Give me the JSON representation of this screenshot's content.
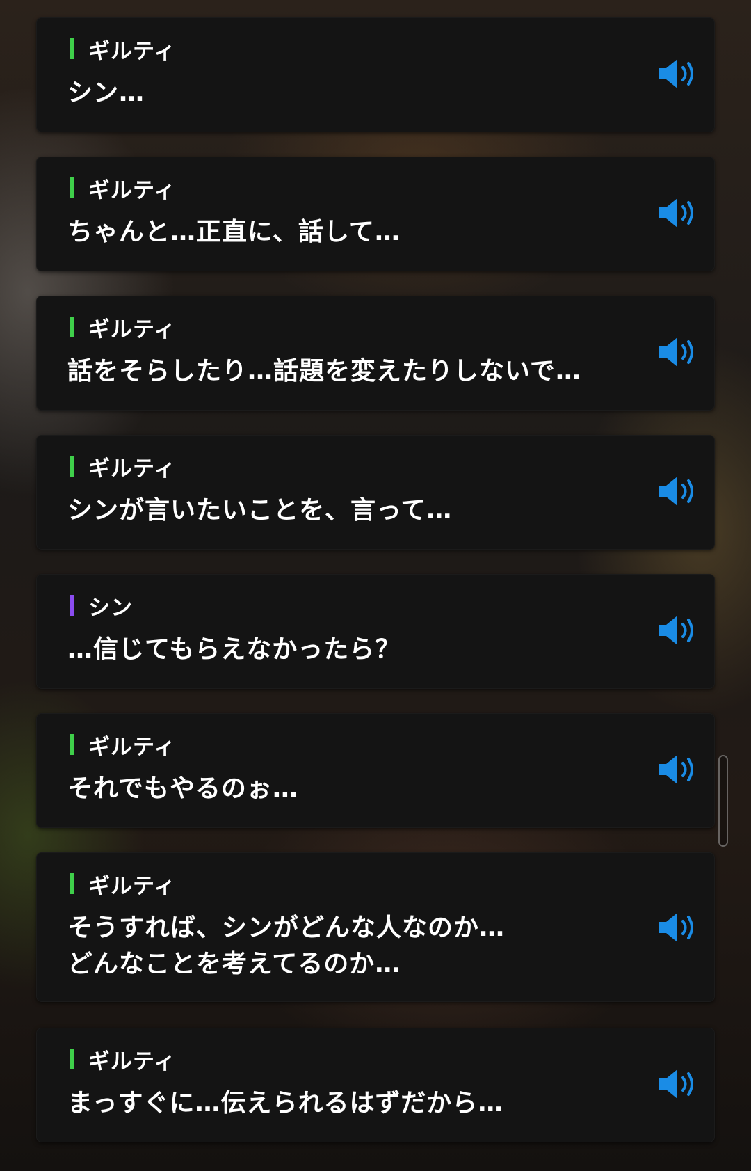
{
  "colors": {
    "speaker_bar_guilty": "#3fcf4a",
    "speaker_bar_shin": "#8b4cf0",
    "voice_icon": "#1a8ce6",
    "card_background": "#141414"
  },
  "log": [
    {
      "speaker": "ギルティ",
      "bar": "guilty",
      "lines": [
        "シン…"
      ],
      "icon": "speaker-voice-icon"
    },
    {
      "speaker": "ギルティ",
      "bar": "guilty",
      "lines": [
        "ちゃんと…正直に、話して…"
      ],
      "icon": "speaker-voice-icon"
    },
    {
      "speaker": "ギルティ",
      "bar": "guilty",
      "lines": [
        "話をそらしたり…話題を変えたりしないで…"
      ],
      "icon": "speaker-voice-icon"
    },
    {
      "speaker": "ギルティ",
      "bar": "guilty",
      "lines": [
        "シンが言いたいことを、言って…"
      ],
      "icon": "speaker-voice-icon"
    },
    {
      "speaker": "シン",
      "bar": "shin",
      "lines": [
        "…信じてもらえなかったら？"
      ],
      "icon": "speaker-voice-icon"
    },
    {
      "speaker": "ギルティ",
      "bar": "guilty",
      "lines": [
        "それでもやるのぉ…"
      ],
      "icon": "speaker-voice-icon"
    },
    {
      "speaker": "ギルティ",
      "bar": "guilty",
      "lines": [
        "そうすれば、シンがどんな人なのか…",
        "どんなことを考えてるのか…"
      ],
      "icon": "speaker-voice-icon"
    },
    {
      "speaker": "ギルティ",
      "bar": "guilty",
      "lines": [
        "まっすぐに…伝えられるはずだから…"
      ],
      "icon": "speaker-voice-icon"
    }
  ]
}
